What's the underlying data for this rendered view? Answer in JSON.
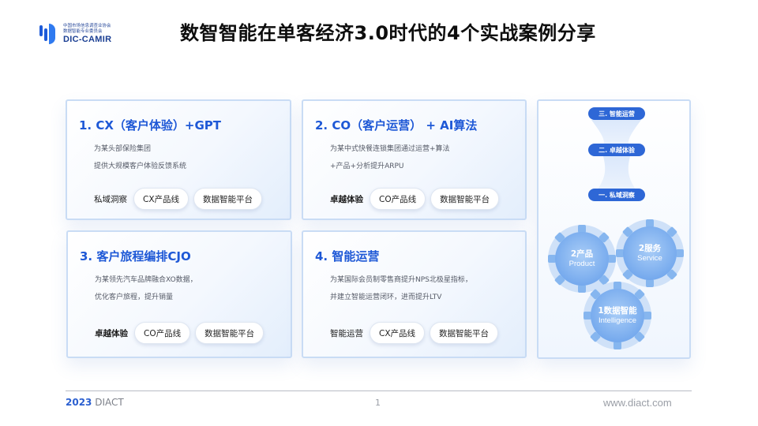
{
  "logo": {
    "org_line1": "中国市场信息调查业协会",
    "org_line2": "数据智能专业委员会",
    "brand": "DIC-CAMIR"
  },
  "header": {
    "title": "数智智能在单客经济3.0时代的4个实战案例分享"
  },
  "cards": [
    {
      "title": "1. CX（客户体验）+GPT",
      "desc1": "为某头部保险集团",
      "desc2": "提供大规模客户体验反馈系统",
      "label": "私域洞察",
      "pills": [
        "CX产品线",
        "数据智能平台"
      ]
    },
    {
      "title": "2. CO（客户运营） + AI算法",
      "desc1": "为某中式快餐连锁集团通过运营+算法",
      "desc2": "+产品+分析提升ARPU",
      "label": "卓越体验",
      "pills": [
        "CO产品线",
        "数据智能平台"
      ]
    },
    {
      "title": "3. 客户旅程编排CJO",
      "desc1": "为某领先汽车品牌融合XO数据，",
      "desc2": "优化客户旅程，提升销量",
      "label": "卓越体验",
      "pills": [
        "CO产品线",
        "数据智能平台"
      ]
    },
    {
      "title": "4. 智能运营",
      "desc1": "为某国际会员制零售商提升NPS北极星指标，",
      "desc2": "并建立智能运营闭环，进而提升LTV",
      "label": "智能运营",
      "pills": [
        "CX产品线",
        "数据智能平台"
      ]
    }
  ],
  "panel": {
    "steps": [
      "三. 智能运营",
      "二. 卓越体验",
      "一. 私域洞察"
    ],
    "gears": [
      {
        "cn": "2产品",
        "en": "Product"
      },
      {
        "cn": "2服务",
        "en": "Service"
      },
      {
        "cn": "1数据智能",
        "en": "Intelligence"
      }
    ]
  },
  "footer": {
    "year": "2023",
    "org": "DIACT",
    "page": "1",
    "url": "www.diact.com"
  },
  "colors": {
    "accent": "#1e58d6",
    "card_border": "#c9dcf5",
    "step_bg": "#2e67d6",
    "gear_fill": "#7fb3f0"
  }
}
